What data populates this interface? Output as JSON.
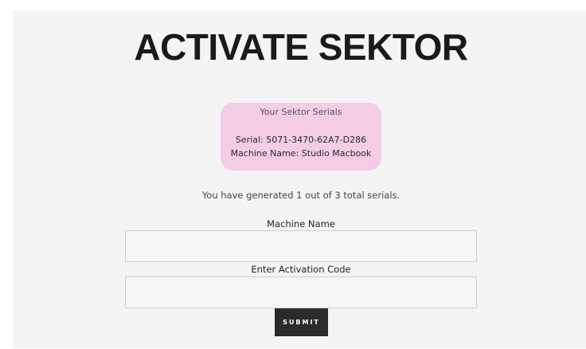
{
  "page": {
    "title": "ACTIVATE SEKTOR"
  },
  "serials_box": {
    "heading": "Your Sektor Serials",
    "serial_line": "Serial: 5071-3470-62A7-D286",
    "machine_line": "Machine Name: Studio Macbook"
  },
  "status": {
    "count_text": "You have generated 1 out of 3 total serials."
  },
  "form": {
    "machine_name_label": "Machine Name",
    "machine_name_value": "",
    "activation_code_label": "Enter Activation Code",
    "activation_code_value": "",
    "submit_label": "SUBMIT"
  },
  "colors": {
    "panel_background": "#f4f4f4",
    "serials_box_background": "#f4cce6",
    "submit_background": "#2b2b2b"
  }
}
